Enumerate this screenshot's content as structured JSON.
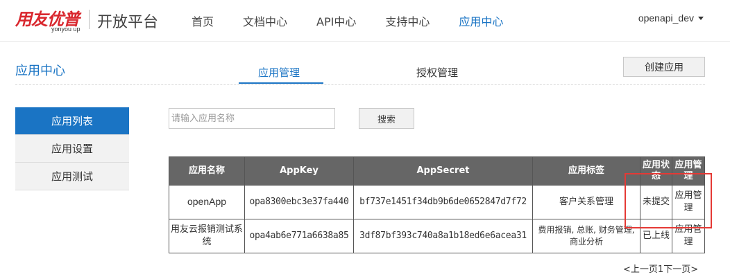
{
  "header": {
    "logo_text": "用友优普",
    "logo_sub": "yonyou up",
    "platform": "开放平台",
    "nav": [
      "首页",
      "文档中心",
      "API中心",
      "支持中心",
      "应用中心"
    ],
    "active_nav_index": 4,
    "user": "openapi_dev"
  },
  "sub": {
    "page_title": "应用中心",
    "tabs": [
      "应用管理",
      "授权管理"
    ],
    "active_tab_index": 0,
    "create_button": "创建应用"
  },
  "sidebar": {
    "items": [
      "应用列表",
      "应用设置",
      "应用测试"
    ],
    "active_index": 0
  },
  "search": {
    "placeholder": "请输入应用名称",
    "value": "",
    "button": "搜索"
  },
  "table": {
    "headers": [
      "应用名称",
      "AppKey",
      "AppSecret",
      "应用标签",
      "应用状态",
      "应用管理"
    ],
    "rows": [
      {
        "name": "openApp",
        "app_key": "opa8300ebc3e37fa440",
        "app_secret": "bf737e1451f34db9b6de0652847d7f72",
        "tags": "客户关系管理",
        "status": "未提交",
        "action": "应用管理"
      },
      {
        "name": "用友云报销测试系统",
        "app_key": "opa4ab6e771a6638a85",
        "app_secret": "3df87bf393c740a8a1b18ed6e6acea31",
        "tags": "费用报销, 总账, 财务管理, 商业分析",
        "status": "已上线",
        "action": "应用管理"
      }
    ]
  },
  "pagination": {
    "prev": "<上一页",
    "current": "1",
    "next": "下一页>"
  },
  "colors": {
    "accent": "#1a74c4",
    "brand": "#d9272e",
    "header_bg": "#666666",
    "highlight": "#e53935"
  }
}
